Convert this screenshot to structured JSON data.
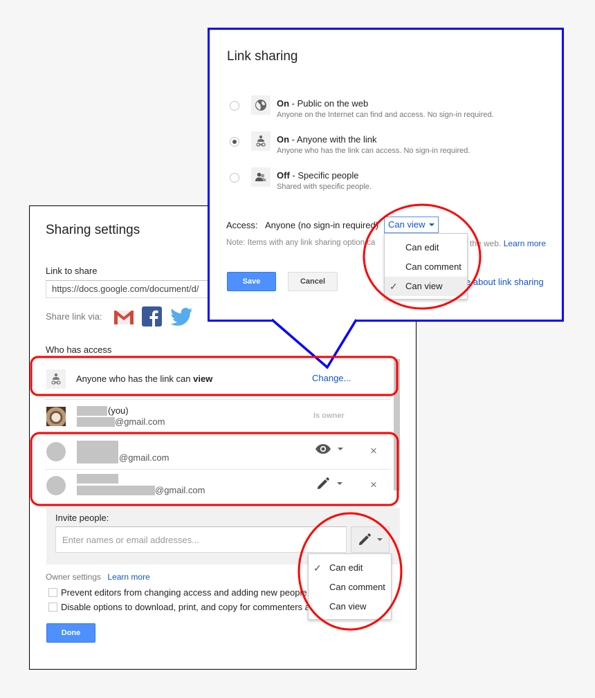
{
  "sharing_settings": {
    "title": "Sharing settings",
    "link_to_share_label": "Link to share",
    "link_value": "https://docs.google.com/document/d/",
    "share_via_label": "Share link via:",
    "share_via_icons": [
      "gmail-icon",
      "facebook-icon",
      "twitter-icon"
    ],
    "who_has_access_label": "Who has access",
    "link_access_row": {
      "text_prefix": "Anyone who has the link can ",
      "text_bold": "view",
      "change_label": "Change..."
    },
    "people": [
      {
        "name_suffix": "(you)",
        "email_suffix": "@gmail.com",
        "role_label": "Is owner",
        "role_icon": "none"
      },
      {
        "name_suffix": "",
        "email_suffix": "@gmail.com",
        "role_icon": "eye-icon",
        "remove": "×"
      },
      {
        "name_suffix": "",
        "email_suffix": "@gmail.com",
        "role_icon": "pencil-icon",
        "remove": "×"
      }
    ],
    "invite": {
      "label": "Invite people:",
      "placeholder": "Enter names or email addresses...",
      "permission_icon": "pencil-icon",
      "menu": [
        {
          "label": "Can edit",
          "checked": true
        },
        {
          "label": "Can comment",
          "checked": false
        },
        {
          "label": "Can view",
          "checked": false
        }
      ]
    },
    "owner_settings_label": "Owner settings",
    "learn_more_label": "Learn more",
    "checkboxes": [
      {
        "label": "Prevent editors from changing access and adding new people",
        "checked": false
      },
      {
        "label": "Disable options to download, print, and copy for commenters and",
        "checked": false
      }
    ],
    "done_label": "Done"
  },
  "link_sharing": {
    "title": "Link sharing",
    "options": [
      {
        "state": "On",
        "title": " - Public on the web",
        "subtitle": "Anyone on the Internet can find and access. No sign-in required.",
        "icon": "globe-icon",
        "selected": false
      },
      {
        "state": "On",
        "title": " - Anyone with the link",
        "subtitle": "Anyone who has the link can access. No sign-in required.",
        "icon": "person-link-icon",
        "selected": true
      },
      {
        "state": "Off",
        "title": " - Specific people",
        "subtitle": "Shared with specific people.",
        "icon": "people-icon",
        "selected": false
      }
    ],
    "access_label": "Access:",
    "access_value": "Anyone (no sign-in required)",
    "access_dropdown_value": "Can view",
    "access_menu": [
      {
        "label": "Can edit",
        "checked": false
      },
      {
        "label": "Can comment",
        "checked": false
      },
      {
        "label": "Can view",
        "checked": true
      }
    ],
    "note_visible_left": "Note: Items with any link sharing option ca",
    "note_visible_right": "the web.",
    "note_learn_more": "Learn more",
    "learn_about_visible": "e about link sharing",
    "save_label": "Save",
    "cancel_label": "Cancel"
  },
  "annotations": {
    "callout_color": "#0000ff",
    "highlight_color": "#ff0000"
  }
}
